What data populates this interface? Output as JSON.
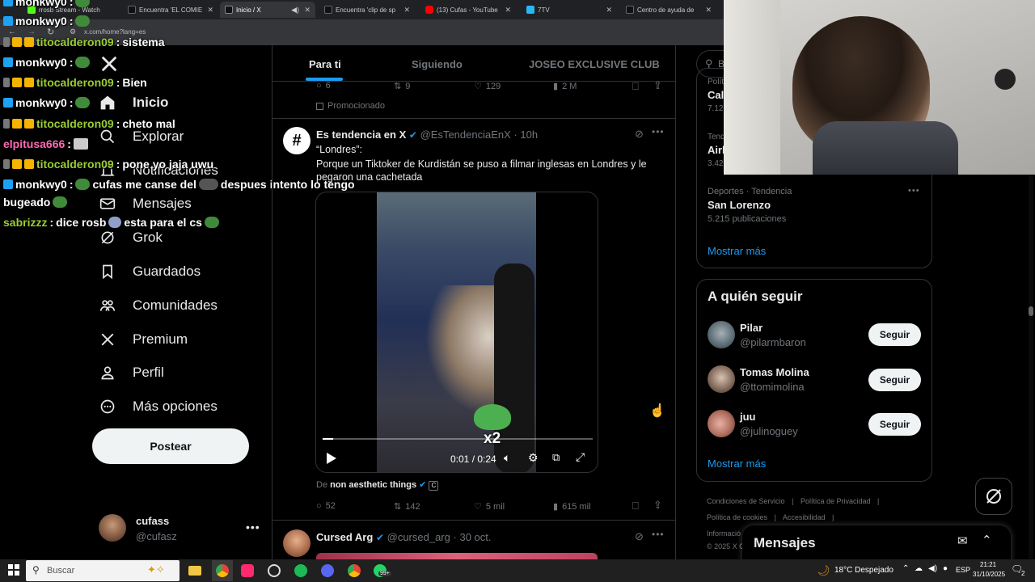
{
  "browser": {
    "tabs": [
      {
        "label": "rrosb Stream - Watch",
        "color": "#53fc18"
      },
      {
        "label": "Encuentra 'EL COMIE",
        "color": "#000000"
      },
      {
        "label": "Inicio / X",
        "color": "#000000",
        "active": true
      },
      {
        "label": "Encuentra 'clip de sp",
        "color": "#000000"
      },
      {
        "label": "(13) Cufas - YouTube",
        "color": "#ff0000"
      },
      {
        "label": "7TV",
        "color": "#29b6f6"
      },
      {
        "label": "Centro de ayuda de",
        "color": "#000000"
      }
    ],
    "url": "x.com/home?lang=es"
  },
  "chat": [
    {
      "user": "monkwy0",
      "user_color": "#ffffff",
      "msg": "",
      "badges": "prime"
    },
    {
      "user": "monkwy0",
      "user_color": "#ffffff",
      "msg": "",
      "badges": "prime"
    },
    {
      "user": "titocalderon09",
      "user_color": "#9acd32",
      "msg": "sistema",
      "badges": "sub"
    },
    {
      "user": "monkwy0",
      "user_color": "#ffffff",
      "msg": "",
      "badges": "prime"
    },
    {
      "user": "titocalderon09",
      "user_color": "#9acd32",
      "msg": "Bien",
      "badges": "sub"
    },
    {
      "user": "monkwy0",
      "user_color": "#ffffff",
      "msg": "",
      "badges": "prime"
    },
    {
      "user": "titocalderon09",
      "user_color": "#9acd32",
      "msg": "cheto mal",
      "badges": "sub"
    },
    {
      "user": "elpitusa666",
      "user_color": "#ff69b4",
      "msg": "",
      "badges": ""
    },
    {
      "user": "titocalderon09",
      "user_color": "#9acd32",
      "msg": "pone yo jaja uwu",
      "badges": "sub"
    },
    {
      "user": "monkwy0",
      "user_color": "#ffffff",
      "msg": "cufas me canse del",
      "msg2": "despues intento lo tengo",
      "badges": "prime"
    },
    {
      "user": "",
      "user_color": "#ffffff",
      "msg": "bugeado",
      "badges": ""
    },
    {
      "user": "sabrizzz",
      "user_color": "#9acd32",
      "msg": "dice rosb",
      "msg2": "esta para el cs",
      "badges": ""
    }
  ],
  "nav": {
    "items": [
      {
        "label": "Inicio",
        "icon": "home-icon"
      },
      {
        "label": "Explorar",
        "icon": "search-icon"
      },
      {
        "label": "Notificaciones",
        "icon": "bell-icon"
      },
      {
        "label": "Mensajes",
        "icon": "mail-icon"
      },
      {
        "label": "Grok",
        "icon": "grok-icon"
      },
      {
        "label": "Guardados",
        "icon": "bookmark-icon"
      },
      {
        "label": "Comunidades",
        "icon": "communities-icon"
      },
      {
        "label": "Premium",
        "icon": "x-logo-icon"
      },
      {
        "label": "Perfil",
        "icon": "person-icon"
      },
      {
        "label": "Más opciones",
        "icon": "more-circle-icon"
      }
    ],
    "post_label": "Postear",
    "account": {
      "name": "cufass",
      "handle": "@cufasz"
    }
  },
  "feed": {
    "tabs": [
      "Para ti",
      "Siguiendo",
      "JOSEO EXCLUSIVE CLUB"
    ],
    "promo": {
      "replies": "6",
      "retweets": "9",
      "likes": "129",
      "views": "2 M",
      "label": "Promocionado"
    },
    "tweet": {
      "name": "Es tendencia en X",
      "handle": "@EsTendenciaEnX",
      "time": "10h",
      "line1": "“Londres”:",
      "line2": "Porque un Tiktoker de Kurdistán se puso a filmar inglesas en Londres y le pegaron una cachetada",
      "video_time": "0:01 / 0:24",
      "overlay": "x2",
      "from_prefix": "De",
      "from_name": "non aesthetic things",
      "replies": "52",
      "retweets": "142",
      "likes": "5 mil",
      "views": "615 mil",
      "progress": 0.04
    },
    "next": {
      "name": "Cursed Arg",
      "handle": "@cursed_arg",
      "time": "30 oct."
    }
  },
  "right": {
    "search_placeholder": "B",
    "trends": [
      {
        "context": "Polít",
        "title": "Cali",
        "count": "7.12"
      },
      {
        "context": "Tend",
        "title": "Airl",
        "count": "3.42"
      },
      {
        "context": "Deportes · Tendencia",
        "title": "San Lorenzo",
        "count": "5.215 publicaciones"
      }
    ],
    "show_more": "Mostrar más",
    "who_to_follow_title": "A quién seguir",
    "follow": [
      {
        "name": "Pilar",
        "handle": "@pilarmbaron"
      },
      {
        "name": "Tomas Molina",
        "handle": "@ttomimolina"
      },
      {
        "name": "juu",
        "handle": "@julinoguey"
      }
    ],
    "follow_label": "Seguir",
    "show_more2": "Mostrar más",
    "footer": [
      "Condiciones de Servicio",
      "Política de Privacidad",
      "Política de cookies",
      "Accesibilidad",
      "Informació",
      "© 2025 X C"
    ]
  },
  "dm": {
    "title": "Mensajes"
  },
  "taskbar": {
    "search_placeholder": "Buscar",
    "weather": "18°C  Despejado",
    "lang": "ESP",
    "time": "21:21",
    "date": "31/10/2025",
    "notif_count": "2",
    "badge": "99+"
  }
}
